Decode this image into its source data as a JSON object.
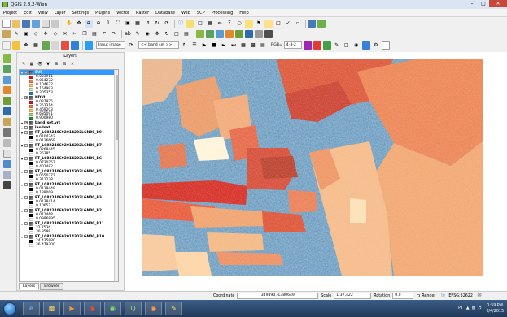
{
  "window": {
    "title": "QGIS 2.8.2-Wien"
  },
  "menu": [
    "Project",
    "Edit",
    "View",
    "Layer",
    "Settings",
    "Plugins",
    "Vector",
    "Raster",
    "Database",
    "Web",
    "SCP",
    "Processing",
    "Help"
  ],
  "toolbar3": {
    "input_combo": "Input image",
    "band_set_combo": "<< band set >>",
    "rgb_label": "RGB=",
    "rgb_value": "4-3-2"
  },
  "layers_panel": {
    "title": "Layers",
    "rows": [
      {
        "kind": "layer",
        "name": "EVI",
        "selected": true,
        "checked": true
      },
      {
        "kind": "value",
        "label": "0.003911",
        "color": "#d7191c"
      },
      {
        "kind": "value",
        "label": "0.054272",
        "color": "#f47c4b"
      },
      {
        "kind": "value",
        "label": "0.104632",
        "color": "#fbc97a"
      },
      {
        "kind": "value",
        "label": "0.154993",
        "color": "#d6eab4"
      },
      {
        "kind": "value",
        "label": "0.205353",
        "color": "#2b83ba"
      },
      {
        "kind": "layer",
        "name": "NDVI",
        "selected": false,
        "checked": true
      },
      {
        "kind": "value",
        "label": "0.037925",
        "color": "#d7191c"
      },
      {
        "kind": "value",
        "label": "0.253314",
        "color": "#f47c4b"
      },
      {
        "kind": "value",
        "label": "0.469203",
        "color": "#fbc97a"
      },
      {
        "kind": "value",
        "label": "0.685091",
        "color": "#a6d96a"
      },
      {
        "kind": "value",
        "label": "0.900980",
        "color": "#1a9641"
      },
      {
        "kind": "layer",
        "name": "band_set.vrt",
        "selected": false,
        "checked": true
      },
      {
        "kind": "layer",
        "name": "landsat",
        "selected": false,
        "checked": false
      },
      {
        "kind": "layer",
        "name": "RT_LC82240692014202LGN00_B9",
        "selected": false,
        "checked": false
      },
      {
        "kind": "value",
        "label": "0.0104242",
        "color": "#000000"
      },
      {
        "kind": "value",
        "label": "0.0116669",
        "color": "#ffffff"
      },
      {
        "kind": "layer",
        "name": "RT_LC82240692014202LGN00_B7",
        "selected": false,
        "checked": false
      },
      {
        "kind": "value",
        "label": "0.0268445",
        "color": "#000000"
      },
      {
        "kind": "value",
        "label": "0.25385",
        "color": "#ffffff"
      },
      {
        "kind": "layer",
        "name": "RT_LC82240692014202LGN00_B6",
        "selected": false,
        "checked": false
      },
      {
        "kind": "value",
        "label": "0.0730757",
        "color": "#000000"
      },
      {
        "kind": "value",
        "label": "0.401482",
        "color": "#ffffff"
      },
      {
        "kind": "layer",
        "name": "RT_LC82240692014202LGN00_B5",
        "selected": false,
        "checked": false
      },
      {
        "kind": "value",
        "label": "0.0650371",
        "color": "#000000"
      },
      {
        "kind": "value",
        "label": "0.311278",
        "color": "#ffffff"
      },
      {
        "kind": "layer",
        "name": "RT_LC82240692014202LGN00_B4",
        "selected": false,
        "checked": false
      },
      {
        "kind": "value",
        "label": "0.0139449",
        "color": "#000000"
      },
      {
        "kind": "value",
        "label": "0.188009",
        "color": "#ffffff"
      },
      {
        "kind": "layer",
        "name": "RT_LC82240692014202LGN00_B3",
        "selected": false,
        "checked": false
      },
      {
        "kind": "value",
        "label": "0.0138414",
        "color": "#000000"
      },
      {
        "kind": "value",
        "label": "0.10652",
        "color": "#ffffff"
      },
      {
        "kind": "layer",
        "name": "RT_LC82240692014202LGN00_B2",
        "selected": false,
        "checked": false
      },
      {
        "kind": "value",
        "label": "0.011468",
        "color": "#000000"
      },
      {
        "kind": "value",
        "label": "0.0996895",
        "color": "#ffffff"
      },
      {
        "kind": "layer",
        "name": "RT_LC82240692014202LGN00_B11",
        "selected": false,
        "checked": false
      },
      {
        "kind": "value",
        "label": "22.7536",
        "color": "#000000"
      },
      {
        "kind": "value",
        "label": "30.8598",
        "color": "#ffffff"
      },
      {
        "kind": "layer",
        "name": "RT_LC82240692014202LGN00_B10",
        "selected": false,
        "checked": false
      },
      {
        "kind": "value",
        "label": "24.435880",
        "color": "#000000"
      },
      {
        "kind": "value",
        "label": "36.479200",
        "color": "#ffffff"
      }
    ],
    "tabs": [
      "Layers",
      "Browser"
    ]
  },
  "status": {
    "coordinate_label": "Coordinate",
    "coordinate": "349490,-1380649",
    "scale_label": "Scale",
    "scale": "1:37,422",
    "rotation_label": "Rotation",
    "rotation": "0.0",
    "render_label": "Render",
    "crs": "EPSG:32622"
  },
  "taskbar": {
    "language": "PT",
    "time": "1:59 PM",
    "date": "6/4/2015"
  },
  "colors": {
    "map_red": "#d7191c",
    "map_orange": "#f4a582",
    "map_blue": "#2b83ba",
    "map_lightblue": "#abd9e9",
    "map_yellow": "#ffffbf"
  }
}
